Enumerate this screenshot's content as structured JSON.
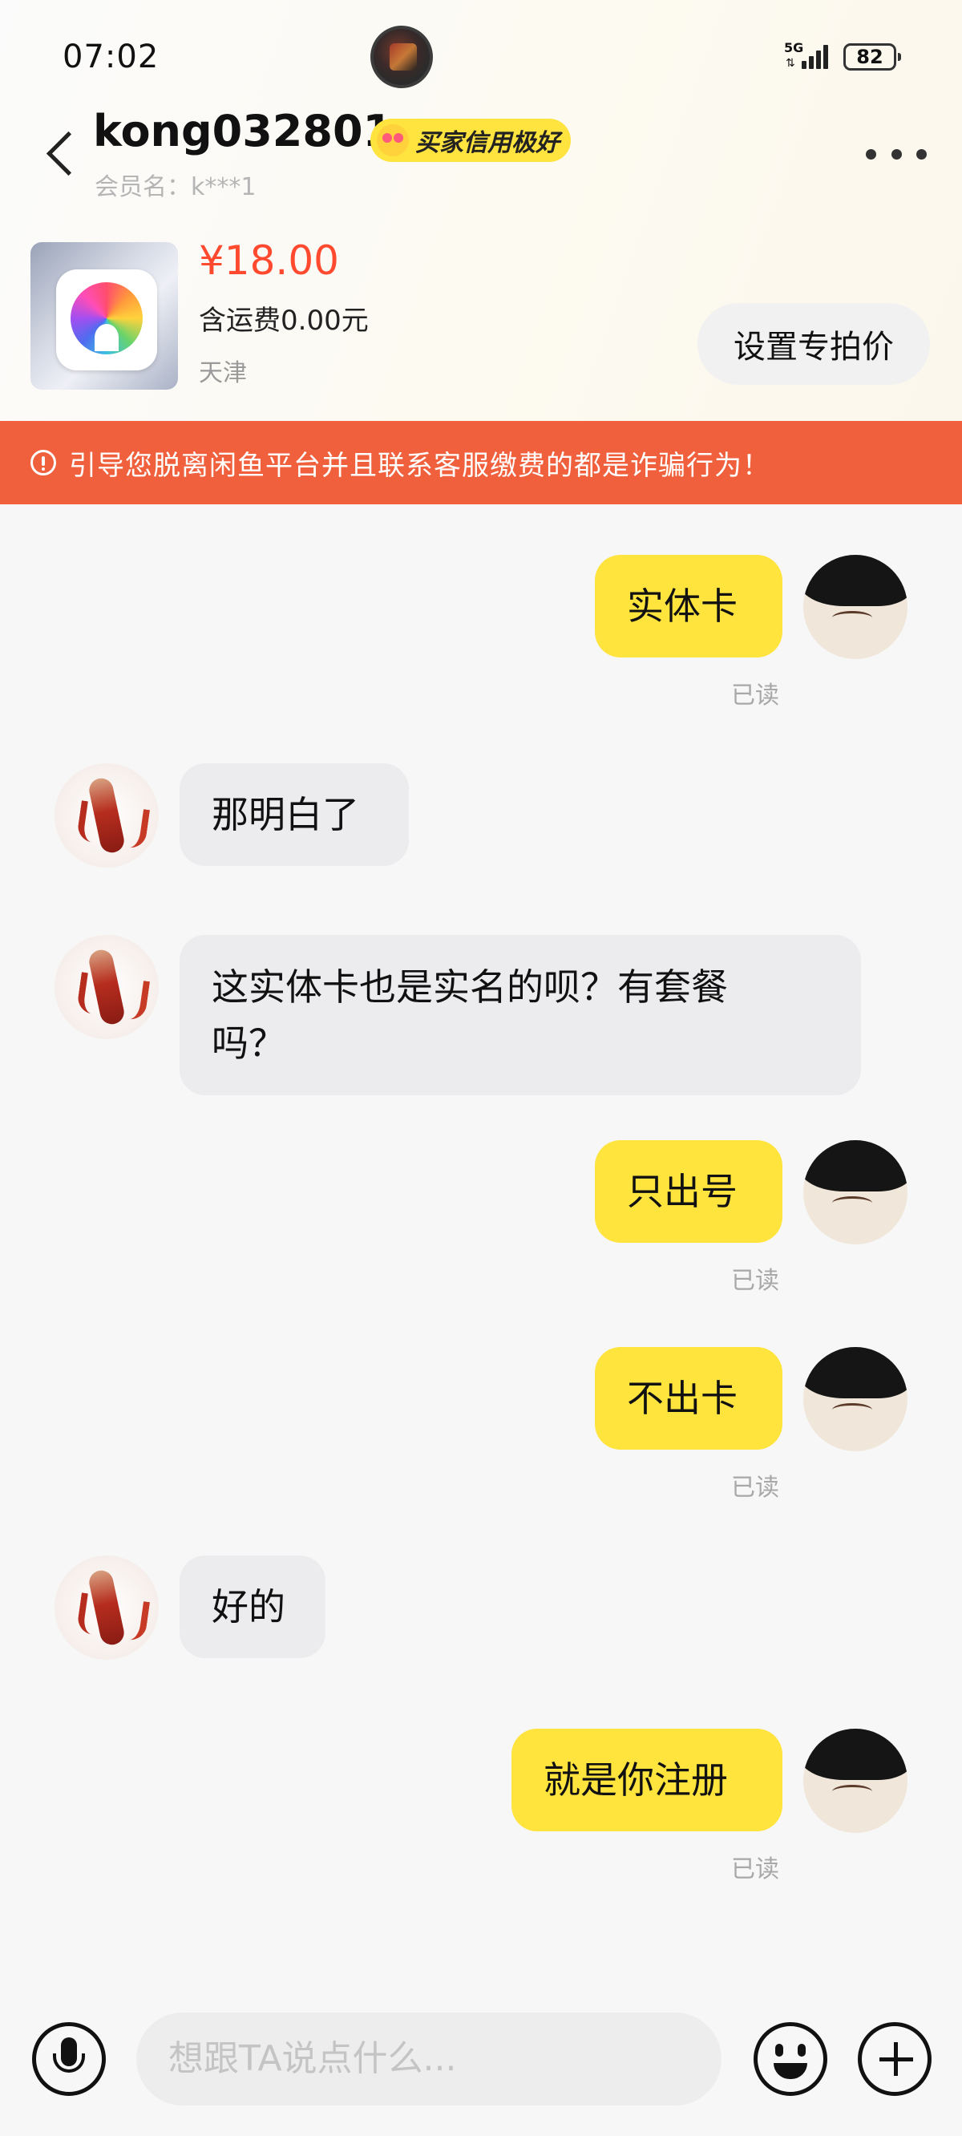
{
  "status_bar": {
    "time": "07:02",
    "network": "5G",
    "battery": "82"
  },
  "header": {
    "username": "kong032801",
    "badge": "买家信用极好",
    "member_label": "会员名：k***1"
  },
  "product": {
    "price": "¥18.00",
    "shipping": "含运费0.00元",
    "location": "天津",
    "set_price_button": "设置专拍价"
  },
  "warning": "引导您脱离闲鱼平台并且联系客服缴费的都是诈骗行为！",
  "messages": [
    {
      "sender": "me",
      "text": "实体卡",
      "status": "已读"
    },
    {
      "sender": "them",
      "text": "那明白了"
    },
    {
      "sender": "them",
      "text": "这实体卡也是实名的呗？有套餐",
      "text2": "吗？"
    },
    {
      "sender": "me",
      "text": "只出号",
      "status": "已读"
    },
    {
      "sender": "me",
      "text": "不出卡",
      "status": "已读"
    },
    {
      "sender": "them",
      "text": "好的"
    },
    {
      "sender": "me",
      "text": "就是你注册",
      "status": "已读"
    }
  ],
  "input": {
    "placeholder": "想跟TA说点什么..."
  },
  "colors": {
    "accent_yellow": "#ffe43e",
    "warning_bg": "#f0603c",
    "price_red": "#ff4a2f"
  },
  "icons": [
    "back-icon",
    "more-icon",
    "warning-icon",
    "mic-icon",
    "emoji-icon",
    "plus-icon"
  ]
}
